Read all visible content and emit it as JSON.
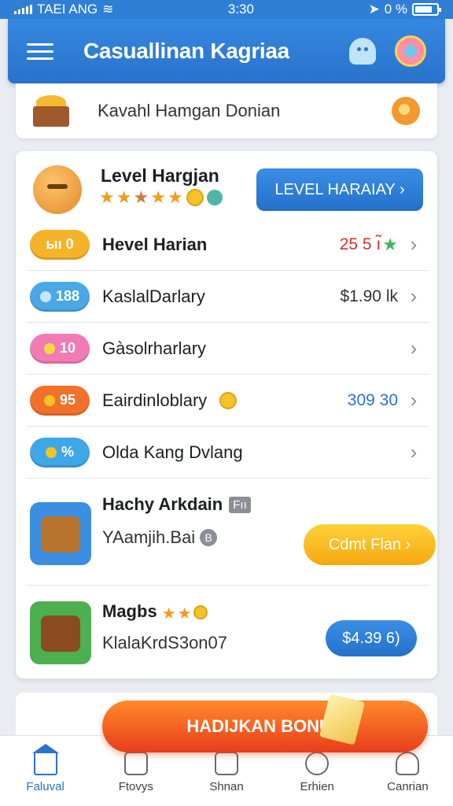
{
  "status_bar": {
    "carrier": "TAEI ANG",
    "time": "3:30",
    "battery": "0 %",
    "battery_level": 0.8
  },
  "app_bar": {
    "title": "Casuallinan Kagriaa"
  },
  "banner": {
    "text": "Kavahl Hamgan Donian"
  },
  "card": {
    "header": {
      "title": "Level Hargjan",
      "button_label": "LEVEL HARAIAY ›",
      "stars": 5
    },
    "rows": [
      {
        "pill": "ыı 0",
        "pill_color": "#f5b32a",
        "label": "Hevel Harian",
        "value": "25 5 ı̃",
        "value_color": "#d63131"
      },
      {
        "pill": "188",
        "pill_color": "#4aa8e6",
        "label": "KaslalDarlary",
        "value": "$1.90 lk",
        "value_color": "#333333"
      },
      {
        "pill": "10",
        "pill_color": "#f27bb5",
        "label": "Gàsolrharlary",
        "value": "",
        "value_color": "#333333"
      },
      {
        "pill": "95",
        "pill_color": "#f2712a",
        "label": "Eairdinloblary",
        "value": "309 30",
        "value_color": "#2a72cc"
      },
      {
        "pill": "%",
        "pill_color": "#3fa6e8",
        "label": "Olda Kang Dvlang",
        "value": "",
        "value_color": "#333333"
      }
    ],
    "promos": [
      {
        "title": "Hachy Arkdain",
        "tag": "Fıı",
        "subtitle": "YAamjih.Bai",
        "sub_tag": "B",
        "button_label": "Cdmt Flan ›"
      },
      {
        "title": "Magbs",
        "subtitle": "KlalaKrdS3on07",
        "button_label": "$4.39 6)"
      }
    ]
  },
  "bonus_button": {
    "label": "HADIJKAN BONUS"
  },
  "tabs": [
    {
      "label": "Faluval",
      "icon": "home-icon",
      "active": true
    },
    {
      "label": "Ftovys",
      "icon": "gift-icon",
      "active": false
    },
    {
      "label": "Shnan",
      "icon": "shop-icon",
      "active": false
    },
    {
      "label": "Erhien",
      "icon": "compass-icon",
      "active": false
    },
    {
      "label": "Canrian",
      "icon": "user-icon",
      "active": false
    }
  ]
}
